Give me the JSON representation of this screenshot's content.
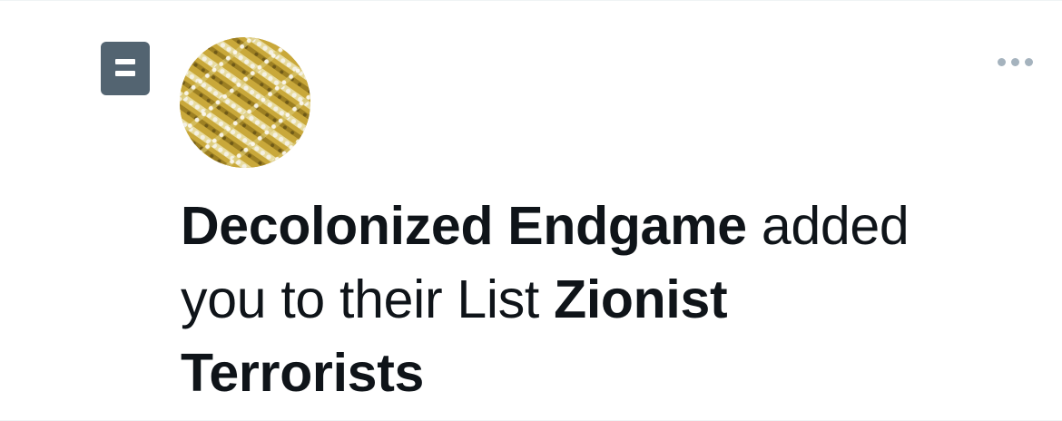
{
  "notification": {
    "icon": "list-icon",
    "avatar": {
      "description_icon": "avatar-image"
    },
    "more_icon": "more-horizontal-icon",
    "text": {
      "actor": "Decolonized Endgame",
      "action": " added",
      "middle": "you to their List ",
      "list_name_line1": "Zionist",
      "list_name_line2": "Terrorists"
    }
  },
  "colors": {
    "text": "#0f1419",
    "icon_badge": "#536471",
    "muted_dots": "#a5b3be",
    "border": "#eff3f4"
  }
}
